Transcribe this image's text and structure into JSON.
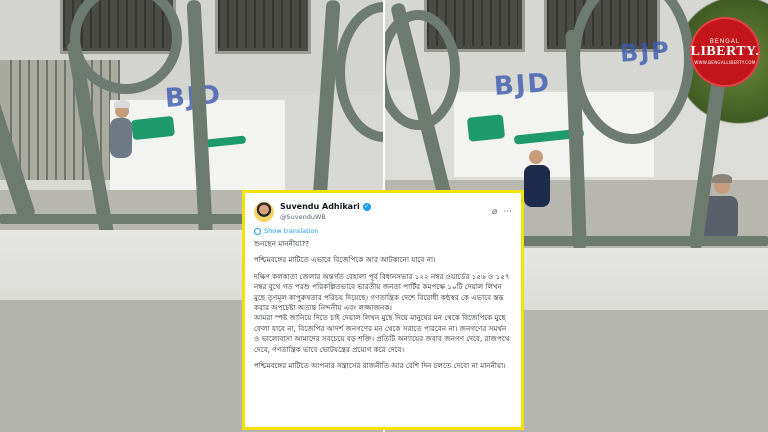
{
  "logo": {
    "top": "BENGAL",
    "main": "LIBERTY.",
    "sub": "WWW.BENGALLIBERTY.COM"
  },
  "graffiti": {
    "left_letters": "BJD",
    "right_letters": "BJD",
    "right_letters2": "BJP"
  },
  "tweet": {
    "author_name": "Suvendu Adhikari",
    "handle": "@SuvenduWB",
    "show_translation": "Show translation",
    "paragraphs": [
      "শুনছেন মাননীয়া??",
      "পশ্চিমবঙ্গের মাটিতে এভাবে বিজেপিকে আর আটকানো যাবে না।",
      "দক্ষিণ কলকাতা জেলার অন্তর্গত বেহালা পূর্ব বিধানসভার ১২২ নম্বর ওয়ার্ডের ১৫৬ ও ১৫৭ নম্বর বুথে গত পরশু পরিকল্পিতভাবে ভারতীয় জনতা পার্টির কমপক্ষে ১০টি দেয়াল লিখন মুছে তৃণমূল কাপুরুষতার পরিচয় দিয়েছে। গণতান্ত্রিক দেশে বিরোধী কন্ঠস্বর কে এভাবে স্তব্ধ করার অপচেষ্টা অত্যন্ত নিন্দনীয় এবং লজ্জাজনক।",
      "আমরা স্পষ্ট জানিয়ে দিতে চাই দেয়াল লিখন মুছে দিয়ে মানুষের মন থেকে বিজেপিকে মুছে ফেলা যাবে না, বিজেপির আদর্শ জনগণের মন থেকে সরাতে পারবেন না। জনগণের সমর্থন ও ভালোবাসা আমাদের সবচেয়ে বড় শক্তি। প্রতিটি অন্যায়ের জবাব জনগণ দেবে, রাজপথে দেবে, গণতান্ত্রিক ভাবে ভোটযন্ত্রের প্রয়োগ করে দেবে।",
      "পশ্চিমবঙ্গের মাটিতে আপনার সন্ত্রাসের রাজনীতি আর বেশি দিন চলতে দেবো না মাননীয়া।"
    ]
  },
  "colors": {
    "logo_red": "#c2161b",
    "tweet_border": "#f2e400",
    "verified_blue": "#1d9bf0",
    "graffiti_green": "#1f9a6d"
  }
}
